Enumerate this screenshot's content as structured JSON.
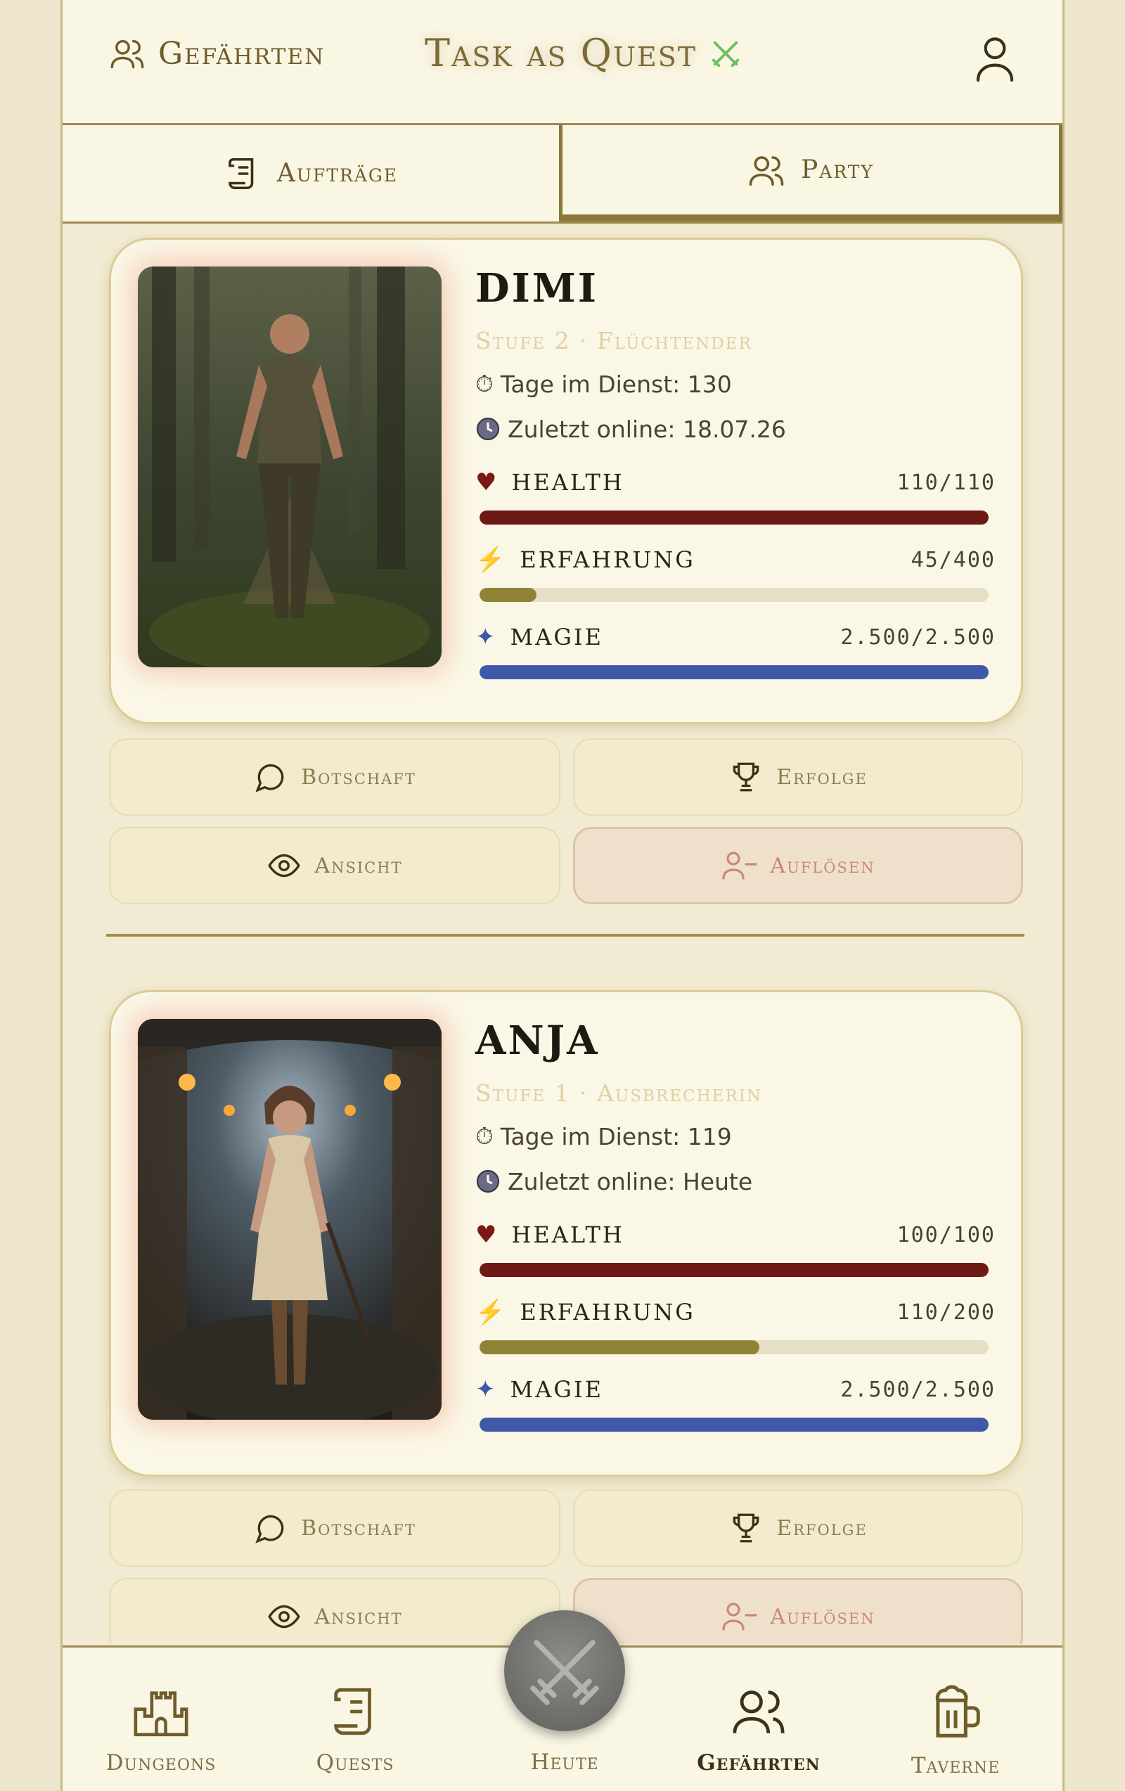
{
  "header": {
    "left_label": "Gefährten",
    "title": "Task as Quest"
  },
  "tabs": [
    {
      "label": "Aufträge",
      "active": false
    },
    {
      "label": "Party",
      "active": true
    }
  ],
  "members": [
    {
      "name": "DIMI",
      "level": "Stufe 2 · Flüchtender",
      "days": "Tage im Dienst: 130",
      "last_online": "Zuletzt online: 18.07.26",
      "stats": {
        "health": {
          "label": "Health",
          "value": "110/110",
          "fraction": 1.0,
          "color": "#6e1a14"
        },
        "xp": {
          "label": "Erfahrung",
          "value": "45/400",
          "fraction": 0.1125,
          "color": "#8f8436"
        },
        "magic": {
          "label": "Magie",
          "value": "2.500/2.500",
          "fraction": 1.0,
          "color": "#3f59a8"
        }
      }
    },
    {
      "name": "ANJA",
      "level": "Stufe 1 · Ausbrecherin",
      "days": "Tage im Dienst: 119",
      "last_online": "Zuletzt online: Heute",
      "stats": {
        "health": {
          "label": "Health",
          "value": "100/100",
          "fraction": 1.0,
          "color": "#6e1a14"
        },
        "xp": {
          "label": "Erfahrung",
          "value": "110/200",
          "fraction": 0.55,
          "color": "#8f8436"
        },
        "magic": {
          "label": "Magie",
          "value": "2.500/2.500",
          "fraction": 1.0,
          "color": "#3f59a8"
        }
      }
    }
  ],
  "actions": {
    "message": "Botschaft",
    "achievements": "Erfolge",
    "view": "Ansicht",
    "dissolve": "Auflösen"
  },
  "nav": [
    {
      "label": "Dungeons",
      "icon": "castle-icon",
      "active": false
    },
    {
      "label": "Quests",
      "icon": "scroll-icon",
      "active": false
    },
    {
      "label": "Heute",
      "icon": "crossed-swords-icon",
      "active": false
    },
    {
      "label": "Gefährten",
      "icon": "users-icon",
      "active": true
    },
    {
      "label": "Taverne",
      "icon": "beer-mug-icon",
      "active": false
    }
  ],
  "colors": {
    "accent": "#8a7638",
    "background": "#f1ebd3",
    "danger": "#c9877b"
  }
}
